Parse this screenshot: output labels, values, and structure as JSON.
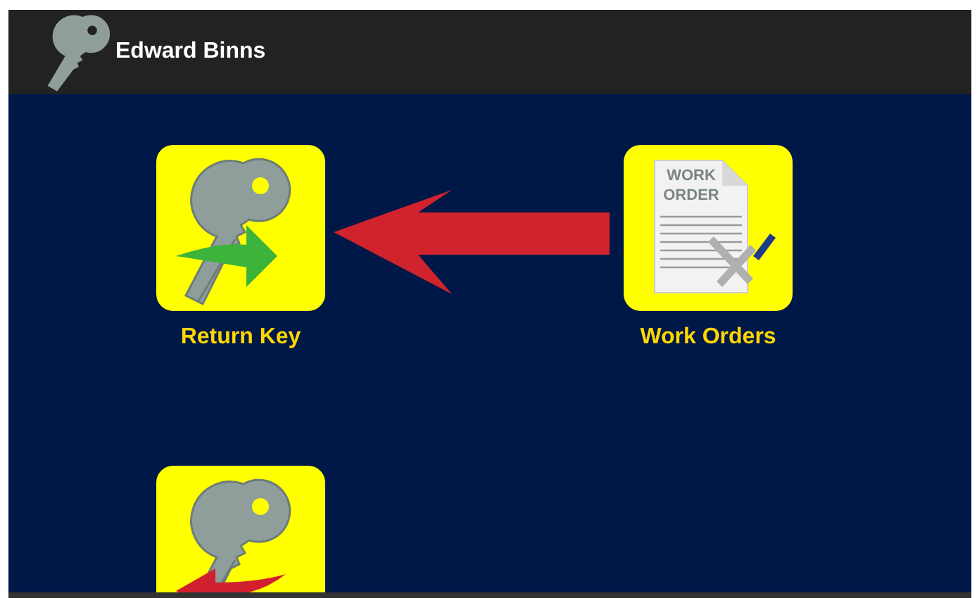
{
  "header": {
    "title": "Edward Binns"
  },
  "tiles": [
    {
      "kind": "return_key",
      "label": "Return Key"
    },
    {
      "kind": "work_orders",
      "label": "Work Orders",
      "doc_label": "WORK ORDER"
    },
    {
      "kind": "issue_key"
    }
  ]
}
